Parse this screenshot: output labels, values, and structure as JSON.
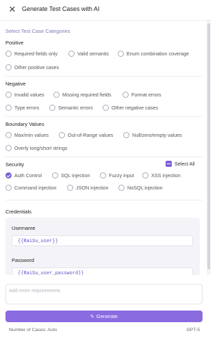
{
  "header": {
    "title": "Generate Test Cases with AI",
    "close_icon": "close-icon"
  },
  "categories_title": "Select Test Case Categories",
  "positive": {
    "title": "Positive",
    "options": [
      "Required fields only",
      "Valid semantic",
      "Enum combination coverage",
      "Other positive cases"
    ]
  },
  "negative": {
    "title": "Negative",
    "options": [
      "Invalid values",
      "Missing required fields",
      "Format errors",
      "Type errors",
      "Semantic errors",
      "Other negative cases"
    ]
  },
  "boundary": {
    "title": "Boundary Values",
    "options": [
      "Max/min values",
      "Out-of-Range values",
      "Null/zero/empty values",
      "Overly long/short strings"
    ]
  },
  "security": {
    "title": "Security",
    "select_all": "Select All",
    "options": [
      "Auth Control",
      "SQL injection",
      "Fuzzy input",
      "XSS injection",
      "Command injection",
      "JSON injection",
      "NoSQL injection"
    ],
    "checked": [
      "Auth Control"
    ]
  },
  "credentials": {
    "title": "Credentials",
    "username_label": "Username",
    "username_value": "{{RaiSu_user}}",
    "password_label": "Password",
    "password_value": "{{RaiSu_user_password}}"
  },
  "requirements": {
    "placeholder": "Add more requirements"
  },
  "generate_button": {
    "label": "Generate",
    "icon": "sparkle-icon"
  },
  "footer": {
    "cases": "Number of Cases: Auto",
    "model": "GPT-5"
  },
  "colors": {
    "accent": "#8a6be0",
    "checked": "#7b5fd6",
    "section": "#7a7ab8"
  }
}
